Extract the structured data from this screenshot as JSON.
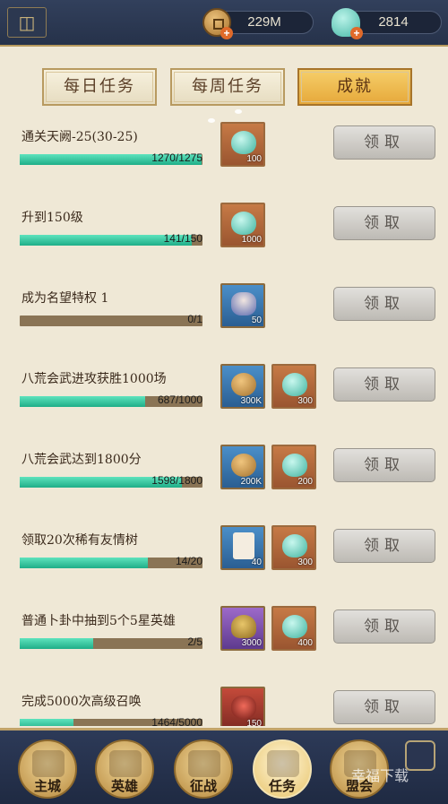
{
  "topbar": {
    "coins": "229M",
    "shells": "2814"
  },
  "tabs": [
    {
      "label": "每日任务",
      "active": false
    },
    {
      "label": "每周任务",
      "active": false
    },
    {
      "label": "成就",
      "active": true
    }
  ],
  "tasks": [
    {
      "title": "通关天阙-25(30-25)",
      "progress": "1270/1275",
      "fraction": 0.996,
      "rewards": [
        {
          "icon": "shell-icon",
          "qty": "100"
        }
      ],
      "claim": "领取"
    },
    {
      "title": "升到150级",
      "progress": "141/150",
      "fraction": 0.94,
      "rewards": [
        {
          "icon": "shell-icon",
          "qty": "1000"
        }
      ],
      "claim": "领取"
    },
    {
      "title": "成为名望特权 1",
      "progress": "0/1",
      "fraction": 0.0,
      "rewards": [
        {
          "icon": "hero-portrait-icon",
          "qty": "50"
        }
      ],
      "claim": "领取"
    },
    {
      "title": "八荒会武进攻获胜1000场",
      "progress": "687/1000",
      "fraction": 0.687,
      "rewards": [
        {
          "icon": "coin-icon",
          "qty": "300K"
        },
        {
          "icon": "shell-icon",
          "qty": "300"
        }
      ],
      "claim": "领取"
    },
    {
      "title": "八荒会武达到1800分",
      "progress": "1598/1800",
      "fraction": 0.888,
      "rewards": [
        {
          "icon": "coin-icon",
          "qty": "200K"
        },
        {
          "icon": "shell-icon",
          "qty": "200"
        }
      ],
      "claim": "领取"
    },
    {
      "title": "领取20次稀有友情树",
      "progress": "14/20",
      "fraction": 0.7,
      "rewards": [
        {
          "icon": "card-icon",
          "qty": "40"
        },
        {
          "icon": "shell-icon",
          "qty": "300"
        }
      ],
      "claim": "领取"
    },
    {
      "title": "普通卜卦中抽到5个5星英雄",
      "progress": "2/5",
      "fraction": 0.4,
      "rewards": [
        {
          "icon": "turtle-shell-icon",
          "qty": "3000"
        },
        {
          "icon": "shell-icon",
          "qty": "400"
        }
      ],
      "claim": "领取"
    },
    {
      "title": "完成5000次高级召唤",
      "progress": "1464/5000",
      "fraction": 0.293,
      "rewards": [
        {
          "icon": "mask-icon",
          "qty": "150"
        }
      ],
      "claim": "领取"
    }
  ],
  "nav": [
    {
      "label": "主城",
      "icon": "city-icon"
    },
    {
      "label": "英雄",
      "icon": "hero-icon"
    },
    {
      "label": "征战",
      "icon": "battle-icon"
    },
    {
      "label": "任务",
      "icon": "scroll-icon",
      "active": true
    },
    {
      "label": "盟会",
      "icon": "guild-icon"
    }
  ],
  "watermark": "幸福下载"
}
